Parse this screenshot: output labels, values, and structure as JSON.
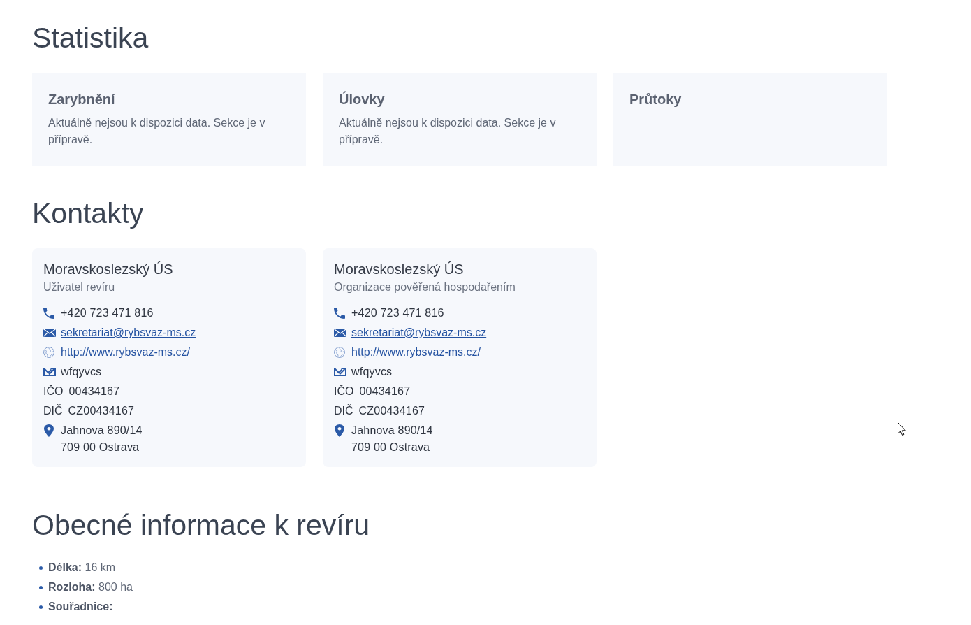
{
  "statistics": {
    "heading": "Statistika",
    "cards": [
      {
        "title": "Zarybnění",
        "text": "Aktuálně nejsou k dispozici data. Sekce je v přípravě."
      },
      {
        "title": "Úlovky",
        "text": "Aktuálně nejsou k dispozici data. Sekce je v přípravě."
      },
      {
        "title": "Průtoky"
      }
    ]
  },
  "contacts": {
    "heading": "Kontakty",
    "cards": [
      {
        "name": "Moravskoslezský ÚS",
        "role": "Uživatel revíru",
        "phone": "+420 723 471 816",
        "email": "sekretariat@rybsvaz-ms.cz",
        "website": "http://www.rybsvaz-ms.cz/",
        "data_box": "wfqyvcs",
        "ico": {
          "label": "IČO",
          "value": "00434167"
        },
        "dic": {
          "label": "DIČ",
          "value": "CZ00434167"
        },
        "address": [
          "Jahnova 890/14",
          "709 00 Ostrava"
        ]
      },
      {
        "name": "Moravskoslezský ÚS",
        "role": "Organizace pověřená hospodařením",
        "phone": "+420 723 471 816",
        "email": "sekretariat@rybsvaz-ms.cz",
        "website": "http://www.rybsvaz-ms.cz/",
        "data_box": "wfqyvcs",
        "ico": {
          "label": "IČO",
          "value": "00434167"
        },
        "dic": {
          "label": "DIČ",
          "value": "CZ00434167"
        },
        "address": [
          "Jahnova 890/14",
          "709 00 Ostrava"
        ]
      }
    ]
  },
  "general_info": {
    "heading": "Obecné informace k revíru",
    "items": [
      {
        "label": "Délka:",
        "value": "16 km"
      },
      {
        "label": "Rozloha:",
        "value": "800 ha"
      },
      {
        "label": "Souřadnice:"
      }
    ]
  }
}
